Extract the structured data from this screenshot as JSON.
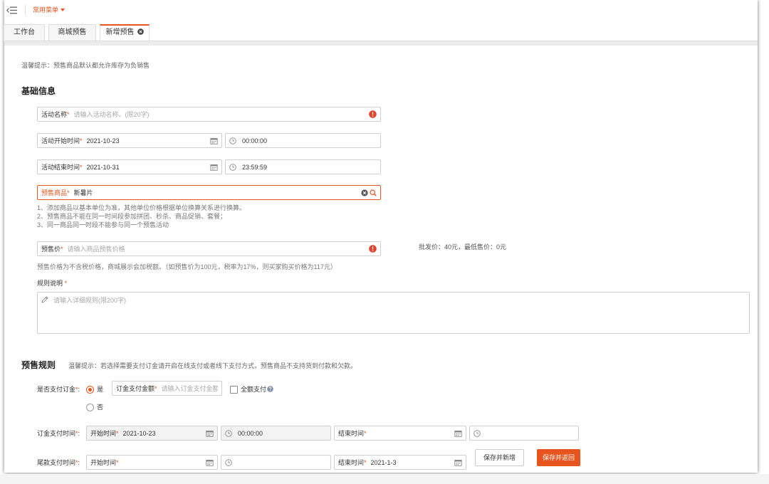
{
  "topbar": {
    "menu_label": "常用菜单"
  },
  "tabs": [
    {
      "label": "工作台"
    },
    {
      "label": "商城预售"
    },
    {
      "label": "新增预售",
      "active": true
    }
  ],
  "required_mark": "*",
  "tip": "温馨提示：预售商品默认都允许库存为负销售",
  "basic_info": {
    "title": "基础信息",
    "activity_name": {
      "label": "活动名称",
      "placeholder": "请输入活动名称。(限20字)"
    },
    "start": {
      "label": "活动开始时间",
      "date": "2021-10-23",
      "time": "00:00:00"
    },
    "end": {
      "label": "活动结束时间",
      "date": "2021-10-31",
      "time": "23:59:59"
    },
    "product": {
      "label": "预售商品",
      "value": "新暑片"
    },
    "product_notes": [
      "1、添加商品以基本单位为准，其他单位价格根据单位换算关系进行换算。",
      "2、预售商品不能在同一时间段参加拼团、秒杀、商品促销、套餐；",
      "3、同一商品同一时段不能参与同一个预售活动"
    ],
    "price": {
      "label": "预售价",
      "placeholder": "请输入商品预售价格",
      "info": "批发价：40元，最低售价：0元",
      "note": "预售价格为不含税价格，商城展示会加税额。（如预售价为100元，税率为17%，则买家购买价格为117元）"
    },
    "rules": {
      "label": "规则说明",
      "placeholder": "请输入详细规则(限200字)"
    }
  },
  "presale_rules": {
    "title": "预售规则",
    "tip": "温馨提示：若选择需要支付订金请开启在线支付或者线下支付方式，预售商品不支持货到付款和欠款。",
    "deposit": {
      "label": "是否支付订金",
      "yes": "是",
      "no": "否",
      "selected": "是",
      "amount_label": "订金支付金额",
      "amount_placeholder": "请输入订金支付金额",
      "full_payment_label": "全额支付",
      "full_payment_checked": false
    },
    "deposit_time": {
      "label": "订金支付时间",
      "start_label": "开始时间",
      "start_date": "2021-10-23",
      "start_time": "00:00:00",
      "end_label": "结束时间",
      "end_date": "",
      "end_time": ""
    },
    "balance_time": {
      "label": "尾款支付时间",
      "start_label": "开始时间",
      "start_date": "",
      "start_time": "",
      "end_label": "结束时间",
      "end_date": "2021-1-3"
    }
  },
  "actions": {
    "save_new": "保存并新增",
    "save_back": "保存并返回"
  },
  "icons": {
    "menu": "menu-collapse-icon",
    "calendar": "calendar-icon",
    "clock": "clock-icon",
    "error": "error-icon",
    "clear": "clear-icon",
    "search": "search-icon",
    "pencil": "pencil-icon",
    "help": "help-icon",
    "tab_close": "close-icon"
  },
  "colors": {
    "accent": "#e8541e",
    "error": "#e0462b",
    "border": "#cfcfcf",
    "disabled_bg": "#f3f3f3"
  }
}
